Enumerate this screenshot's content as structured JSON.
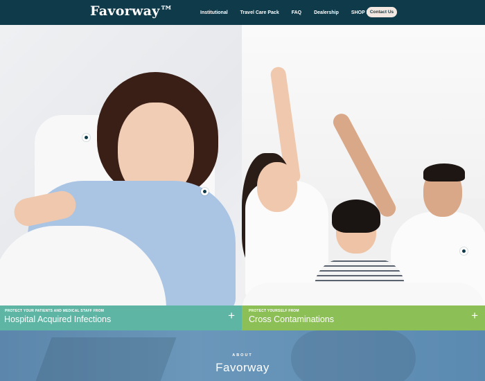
{
  "header": {
    "logo_text": "Favorway™",
    "nav": [
      {
        "label": "Institutional"
      },
      {
        "label": "Travel Care Pack"
      },
      {
        "label": "FAQ"
      },
      {
        "label": "Dealership"
      },
      {
        "label": "SHOP NOW"
      }
    ],
    "contact_label": "Contact Us"
  },
  "hero": {
    "left": {
      "kicker": "PROTECT YOUR PATIENTS AND MEDICAL STAFF FROM",
      "title": "Hospital Acquired Infections",
      "plus": "+"
    },
    "right": {
      "kicker": "PROTECT YOURSELF FROM",
      "title": "Cross Contaminations",
      "plus": "+"
    }
  },
  "about": {
    "kicker": "ABOUT",
    "title": "Favorway"
  },
  "colors": {
    "header_bg": "#0f3a4a",
    "band_left": "#5fb5a3",
    "band_right": "#8cbf55",
    "about_bg": "#6a97ba",
    "contact_bg": "#f3e8e1"
  }
}
